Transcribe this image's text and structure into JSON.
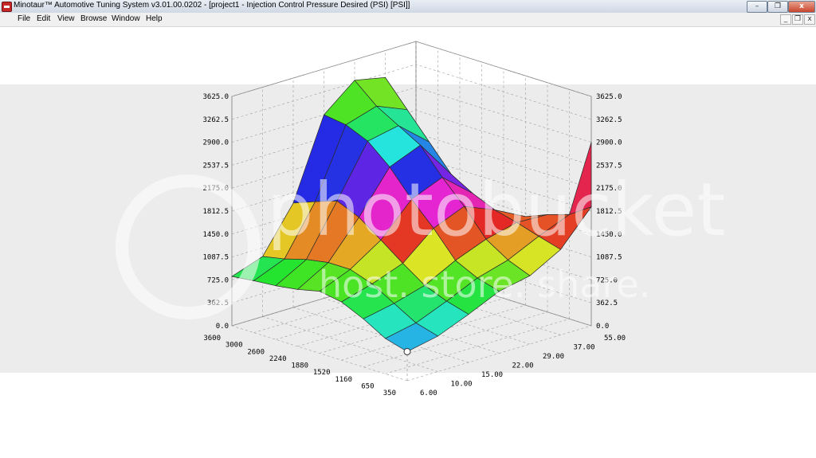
{
  "window": {
    "title": "Minotaur™ Automotive Tuning System  v3.01.00.0202 - [project1 - Injection Control Pressure Desired (PSI) [PSI]]",
    "controls": {
      "minimize": "–",
      "restore": "❐",
      "close": "x"
    }
  },
  "menu": {
    "items": [
      "File",
      "Edit",
      "View",
      "Browse",
      "Window",
      "Help"
    ],
    "mdi": {
      "minimize": "_",
      "restore": "❐",
      "close": "x"
    }
  },
  "watermark": {
    "line1": "photobucket",
    "line2": "host. store. share."
  },
  "colors": {
    "titlebar": "#dbe3ee",
    "menubar": "#f0f0f0",
    "band": "#ececec",
    "grid": "#9e9e9e",
    "marker": "#ffffff"
  },
  "chart_data": {
    "type": "surface",
    "z_ticks": [
      "0.0",
      "362.5",
      "725.0",
      "1087.5",
      "1450.0",
      "1812.5",
      "2175.0",
      "2537.5",
      "2900.0",
      "3262.5",
      "3625.0"
    ],
    "z_range": [
      0,
      3625
    ],
    "rpm_ticks": [
      "350",
      "650",
      "1160",
      "1520",
      "1880",
      "2240",
      "2600",
      "3000",
      "3600"
    ],
    "load_ticks": [
      "6.00",
      "10.00",
      "15.00",
      "22.00",
      "29.00",
      "37.00",
      "55.00"
    ],
    "grid": true,
    "values": [
      [
        460,
        560,
        760,
        980,
        1080,
        1350,
        1880
      ],
      [
        560,
        660,
        860,
        1080,
        1220,
        1450,
        1650
      ],
      [
        760,
        860,
        1000,
        1250,
        1440,
        1560,
        1540
      ],
      [
        920,
        1060,
        1240,
        1650,
        1850,
        1650,
        1400
      ],
      [
        980,
        1180,
        1500,
        2000,
        2200,
        1800,
        1250
      ],
      [
        900,
        1180,
        1750,
        2400,
        2600,
        2000,
        1180
      ],
      [
        850,
        1120,
        1900,
        2700,
        2800,
        2400,
        1090
      ],
      [
        820,
        1020,
        1780,
        2850,
        3000,
        2800,
        1060
      ],
      [
        780,
        950,
        1650,
        2900,
        3300,
        3200,
        1000
      ]
    ],
    "surface_edge": 2900,
    "marker": {
      "rpm": "350",
      "load": "6.00"
    }
  }
}
